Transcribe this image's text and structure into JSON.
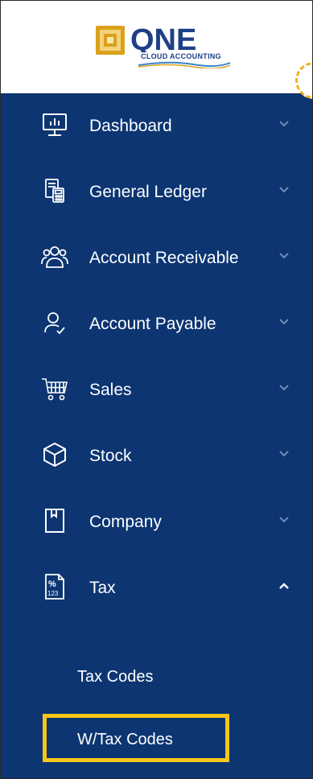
{
  "logo": {
    "wordmark": "QNE",
    "tagline": "CLOUD ACCOUNTING",
    "colors": {
      "gold": "#d9a21c",
      "navy": "#1e3f86",
      "sky": "#3a86c8"
    }
  },
  "sidebar": {
    "background": "#0c3572",
    "items": [
      {
        "label": "Dashboard",
        "icon": "monitor-chart-icon",
        "chevron": "chevron-down-icon"
      },
      {
        "label": "General Ledger",
        "icon": "ledger-calculator-icon",
        "chevron": "chevron-down-icon"
      },
      {
        "label": "Account Receivable",
        "icon": "users-group-icon",
        "chevron": "chevron-down-icon"
      },
      {
        "label": "Account Payable",
        "icon": "user-check-icon",
        "chevron": "chevron-down-icon"
      },
      {
        "label": "Sales",
        "icon": "shopping-cart-icon",
        "chevron": "chevron-down-icon"
      },
      {
        "label": "Stock",
        "icon": "box-icon",
        "chevron": "chevron-down-icon"
      },
      {
        "label": "Company",
        "icon": "bookmark-book-icon",
        "chevron": "chevron-down-icon"
      },
      {
        "label": "Tax",
        "icon": "tax-percent-icon",
        "chevron": "chevron-up-icon",
        "expanded": true
      }
    ],
    "subitems": [
      {
        "label": "Tax Codes"
      },
      {
        "label": "W/Tax Codes",
        "highlighted": true
      }
    ],
    "highlight_color": "#f7c61b"
  }
}
